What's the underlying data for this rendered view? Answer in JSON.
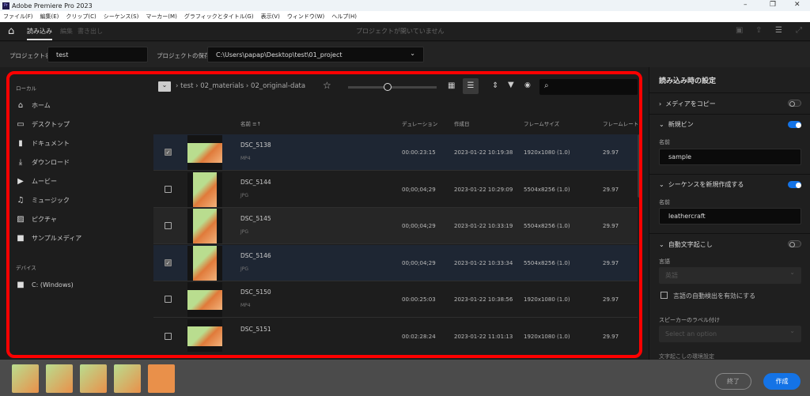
{
  "window": {
    "title": "Adobe Premiere Pro 2023",
    "logo": "Pr",
    "minimize": "–",
    "restore": "❐",
    "close": "✕"
  },
  "menu": [
    "ファイル(F)",
    "編集(E)",
    "クリップ(C)",
    "シーケンス(S)",
    "マーカー(M)",
    "グラフィックとタイトル(G)",
    "表示(V)",
    "ウィンドウ(W)",
    "ヘルプ(H)"
  ],
  "appbar": {
    "tabs": [
      "読み込み",
      "編集",
      "書き出し"
    ],
    "status": "プロジェクトが開いていません"
  },
  "project": {
    "name_label": "プロジェクト名",
    "name_value": "test",
    "location_label": "プロジェクトの保存先",
    "location_value": "C:\\Users\\papap\\Desktop\\test\\01_project"
  },
  "sidebar": {
    "local_heading": "ローカル",
    "items": [
      {
        "icon": "home-icon",
        "glyph": "⌂",
        "label": "ホーム"
      },
      {
        "icon": "desktop-icon",
        "glyph": "▭",
        "label": "デスクトップ"
      },
      {
        "icon": "document-icon",
        "glyph": "▮",
        "label": "ドキュメント"
      },
      {
        "icon": "download-icon",
        "glyph": "⤓",
        "label": "ダウンロード"
      },
      {
        "icon": "movie-icon",
        "glyph": "▶",
        "label": "ムービー"
      },
      {
        "icon": "music-icon",
        "glyph": "♫",
        "label": "ミュージック"
      },
      {
        "icon": "picture-icon",
        "glyph": "▨",
        "label": "ピクチャ"
      },
      {
        "icon": "folder-icon",
        "glyph": "■",
        "label": "サンプルメディア"
      }
    ],
    "devices_heading": "デバイス",
    "devices": [
      {
        "label": "C: (Windows)"
      }
    ]
  },
  "breadcrumb": [
    "test",
    "02_materials",
    "02_original-data"
  ],
  "slider_value": 0.45,
  "table": {
    "headers": {
      "name": "名前",
      "duration": "デュレーション",
      "created": "作成日",
      "frame_size": "フレームサイズ",
      "frame_rate": "フレームレート"
    },
    "rows": [
      {
        "name": "DSC_5138",
        "type": "MP4",
        "duration": "00:00:23:15",
        "created": "2023-01-22 10:19:38",
        "frame_size": "1920x1080 (1.0)",
        "frame_rate": "29.97",
        "checked": true,
        "portrait": false
      },
      {
        "name": "DSC_5144",
        "type": "JPG",
        "duration": "00;00;04;29",
        "created": "2023-01-22 10:29:09",
        "frame_size": "5504x8256 (1.0)",
        "frame_rate": "29.97",
        "checked": false,
        "portrait": true
      },
      {
        "name": "DSC_5145",
        "type": "JPG",
        "duration": "00;00;04;29",
        "created": "2023-01-22 10:33:19",
        "frame_size": "5504x8256 (1.0)",
        "frame_rate": "29.97",
        "checked": false,
        "portrait": true
      },
      {
        "name": "DSC_5146",
        "type": "JPG",
        "duration": "00;00;04;29",
        "created": "2023-01-22 10:33:34",
        "frame_size": "5504x8256 (1.0)",
        "frame_rate": "29.97",
        "checked": true,
        "portrait": true
      },
      {
        "name": "DSC_5150",
        "type": "MP4",
        "duration": "00:00:25:03",
        "created": "2023-01-22 10:38:56",
        "frame_size": "1920x1080 (1.0)",
        "frame_rate": "29.97",
        "checked": false,
        "portrait": false
      },
      {
        "name": "DSC_5151",
        "type": "",
        "duration": "00:02:28:24",
        "created": "2023-01-22 11:01:13",
        "frame_size": "1920x1080 (1.0)",
        "frame_rate": "29.97",
        "checked": false,
        "portrait": false
      }
    ]
  },
  "settings": {
    "title": "読み込み時の設定",
    "copy_media": "メディアをコピー",
    "copy_media_on": false,
    "new_bin": "新規ビン",
    "new_bin_on": true,
    "bin_name_label": "名前",
    "bin_name": "sample",
    "new_sequence": "シーケンスを新規作成する",
    "new_sequence_on": true,
    "seq_name_label": "名前",
    "seq_name": "leathercraft",
    "auto_transcribe": "自動文字起こし",
    "auto_transcribe_on": false,
    "language_label": "言語",
    "language_value": "英語",
    "auto_detect": "言語の自動検出を有効にする",
    "speaker_label": "スピーカーのラベル付け",
    "speaker_placeholder": "Select an option",
    "prefs_label": "文字起こしの環境設定"
  },
  "footer": {
    "exit": "終了",
    "create": "作成"
  },
  "colors": {
    "accent": "#1473e6",
    "highlight": "#ff0000"
  }
}
